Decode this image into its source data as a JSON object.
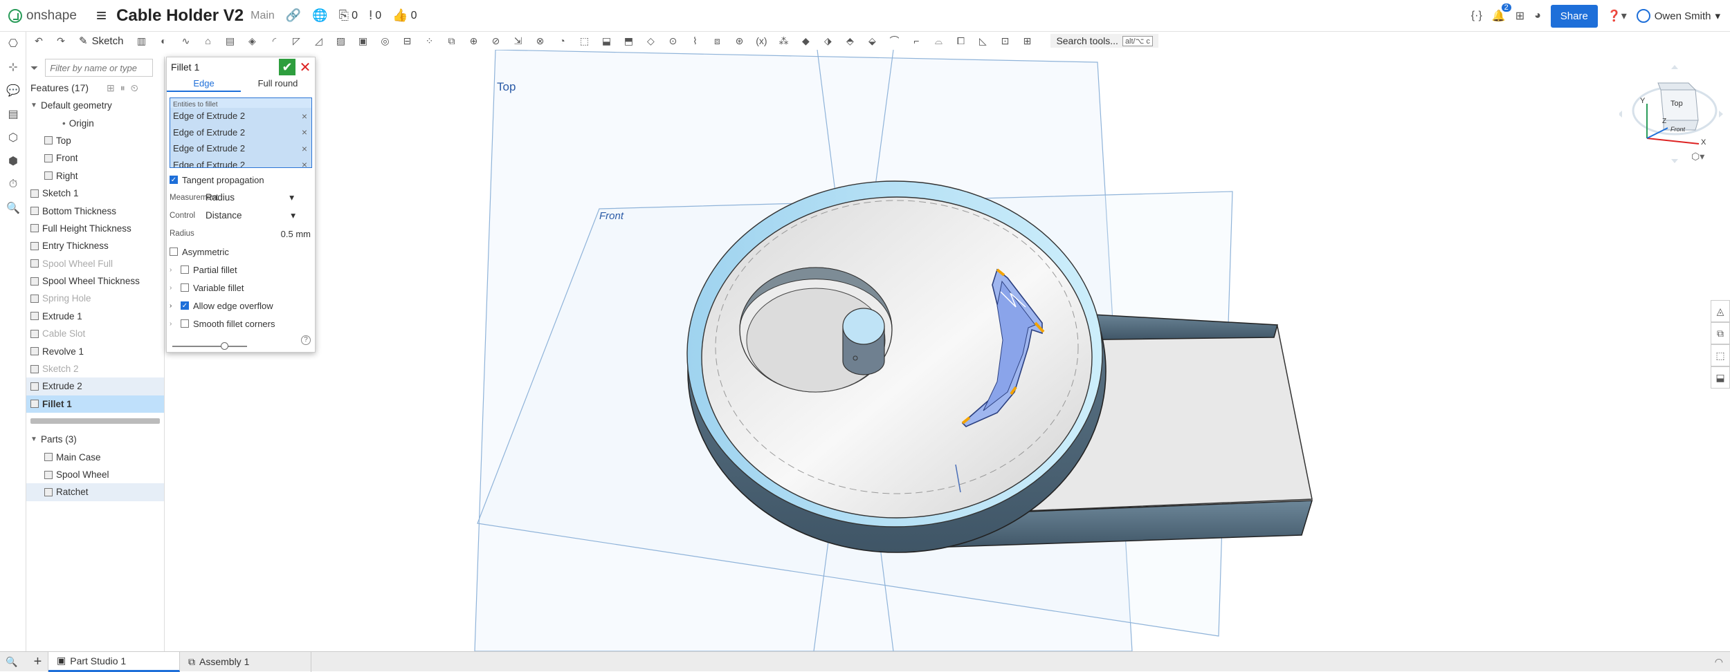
{
  "app": {
    "brand": "onshape",
    "document_title": "Cable Holder V2",
    "branch": "Main",
    "counts": {
      "versions": "0",
      "branches": "0",
      "likes": "0"
    },
    "notifications": "2",
    "share_label": "Share",
    "user_name": "Owen Smith"
  },
  "toolbar": {
    "sketch_label": "Sketch",
    "search_label": "Search tools...",
    "search_shortcut": "alt/⌥ c"
  },
  "tree": {
    "filter_placeholder": "Filter by name or type",
    "features_header": "Features (17)",
    "items": [
      {
        "label": "Default geometry",
        "level": 0,
        "kind": "group"
      },
      {
        "label": "Origin",
        "level": 2,
        "kind": "origin"
      },
      {
        "label": "Top",
        "level": 1,
        "kind": "plane"
      },
      {
        "label": "Front",
        "level": 1,
        "kind": "plane"
      },
      {
        "label": "Right",
        "level": 1,
        "kind": "plane"
      },
      {
        "label": "Sketch 1",
        "level": 0,
        "kind": "sketch"
      },
      {
        "label": "Bottom Thickness",
        "level": 0,
        "kind": "feature"
      },
      {
        "label": "Full Height Thickness",
        "level": 0,
        "kind": "feature"
      },
      {
        "label": "Entry Thickness",
        "level": 0,
        "kind": "feature"
      },
      {
        "label": "Spool Wheel Full",
        "level": 0,
        "kind": "feature",
        "dim": true
      },
      {
        "label": "Spool Wheel Thickness",
        "level": 0,
        "kind": "feature"
      },
      {
        "label": "Spring Hole",
        "level": 0,
        "kind": "feature",
        "dim": true
      },
      {
        "label": "Extrude 1",
        "level": 0,
        "kind": "feature"
      },
      {
        "label": "Cable Slot",
        "level": 0,
        "kind": "sketch",
        "dim": true
      },
      {
        "label": "Revolve 1",
        "level": 0,
        "kind": "feature"
      },
      {
        "label": "Sketch 2",
        "level": 0,
        "kind": "sketch",
        "dim": true
      },
      {
        "label": "Extrude 2",
        "level": 0,
        "kind": "feature",
        "hover": true
      },
      {
        "label": "Fillet 1",
        "level": 0,
        "kind": "feature",
        "selected": true
      }
    ],
    "parts_header": "Parts (3)",
    "parts": [
      "Main Case",
      "Spool Wheel",
      "Ratchet"
    ]
  },
  "dialog": {
    "title": "Fillet 1",
    "tabs": [
      "Edge",
      "Full round"
    ],
    "entities_header": "Entities to fillet",
    "entities": [
      "Edge of Extrude 2",
      "Edge of Extrude 2",
      "Edge of Extrude 2",
      "Edge of Extrude 2"
    ],
    "tangent_propagation": "Tangent propagation",
    "measurement_label": "Measurement",
    "measurement_value": "Radius",
    "control_label": "Control",
    "control_value": "Distance",
    "radius_label": "Radius",
    "radius_value": "0.5 mm",
    "asymmetric": "Asymmetric",
    "partial_fillet": "Partial fillet",
    "variable_fillet": "Variable fillet",
    "allow_edge_overflow": "Allow edge overflow",
    "smooth_fillet_corners": "Smooth fillet corners",
    "help": "?"
  },
  "viewport": {
    "plane_top": "Top",
    "plane_front": "Front",
    "viewcube_top": "Top",
    "viewcube_front": "Front",
    "axis_x": "X",
    "axis_y": "Y",
    "axis_z": "Z"
  },
  "bottom": {
    "tabs": [
      "Part Studio 1",
      "Assembly 1"
    ]
  },
  "colors": {
    "accent": "#1e6fd9",
    "confirm": "#2e9e3e",
    "cancel": "#d22222",
    "selection": "#bfe0fb"
  }
}
